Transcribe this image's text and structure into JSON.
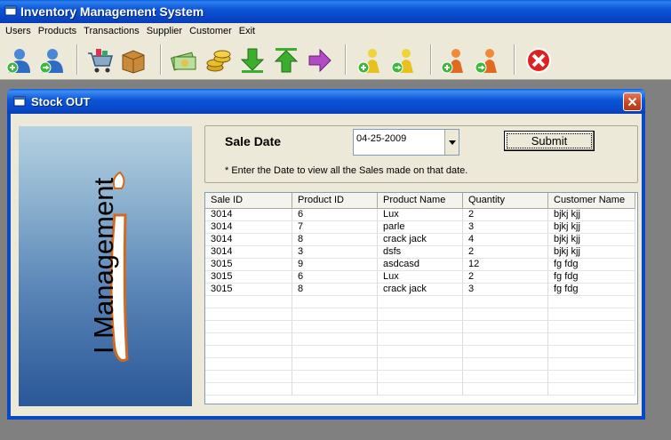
{
  "app": {
    "title": "Inventory Management System"
  },
  "menu": [
    "Users",
    "Products",
    "Transactions",
    "Supplier",
    "Customer",
    "Exit"
  ],
  "toolbar": {
    "buttons": [
      "add-user-icon",
      "logout-user-icon",
      "cart-icon",
      "box-icon",
      "cash-icon",
      "coins-icon",
      "down-arrow-icon",
      "up-arrow-icon",
      "right-arrow-icon",
      "add-customer-icon",
      "go-customer-icon",
      "add-supplier-icon",
      "go-supplier-icon",
      "close-icon"
    ]
  },
  "window": {
    "title": "Stock OUT"
  },
  "logo": {
    "text": "I Management"
  },
  "form": {
    "sale_date_label": "Sale Date",
    "date_value": "04-25-2009",
    "submit_label": "Submit",
    "hint": "* Enter the Date to view all the Sales made on that date."
  },
  "grid": {
    "columns": [
      "Sale ID",
      "Product ID",
      "Product Name",
      "Quantity",
      "Customer Name"
    ],
    "rows": [
      [
        "3014",
        "6",
        "Lux",
        "2",
        "bjkj kjj"
      ],
      [
        "3014",
        "7",
        "parle",
        "3",
        "bjkj kjj"
      ],
      [
        "3014",
        "8",
        "crack jack",
        "4",
        "bjkj kjj"
      ],
      [
        "3014",
        "3",
        "dsfs",
        "2",
        "bjkj kjj"
      ],
      [
        "3015",
        "9",
        "asdcasd",
        "12",
        "fg fdg"
      ],
      [
        "3015",
        "6",
        "Lux",
        "2",
        "fg fdg"
      ],
      [
        "3015",
        "8",
        "crack jack",
        "3",
        "fg fdg"
      ]
    ]
  },
  "colors": {
    "titlebar": "#0b55d6",
    "face": "#ece9d8",
    "mdi": "#808080",
    "close": "#c9431f"
  }
}
